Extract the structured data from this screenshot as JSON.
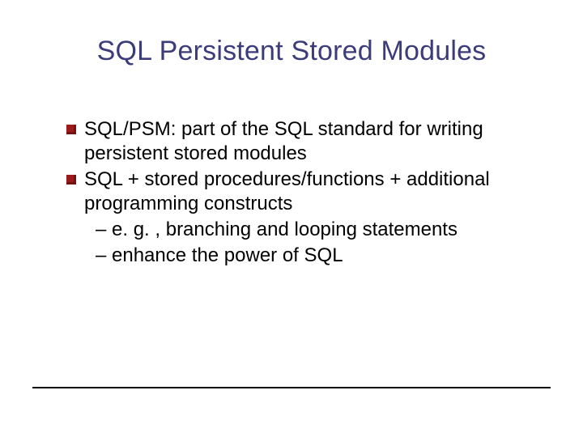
{
  "title": "SQL Persistent Stored Modules",
  "bullets": [
    {
      "text": "SQL/PSM: part of the SQL standard for writing persistent stored modules",
      "subs": []
    },
    {
      "text": "SQL + stored procedures/functions + additional programming constructs",
      "subs": [
        "– e. g. , branching and looping statements",
        "– enhance the power of SQL"
      ]
    }
  ]
}
